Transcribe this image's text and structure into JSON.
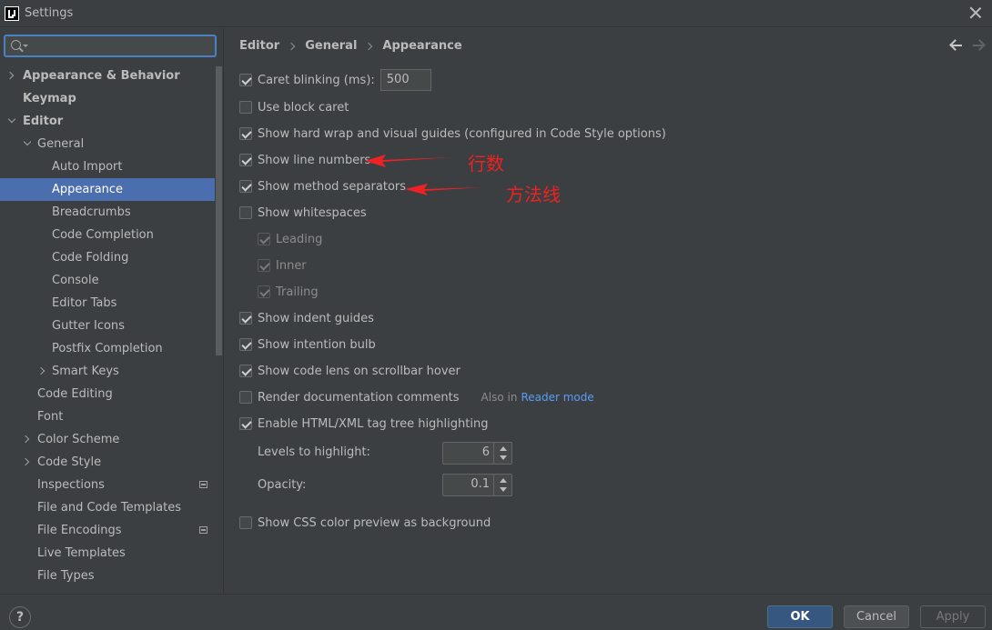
{
  "window": {
    "title": "Settings"
  },
  "search": {
    "value": "",
    "placeholder": ""
  },
  "sidebar": {
    "items": [
      {
        "label": "Appearance & Behavior"
      },
      {
        "label": "Keymap"
      },
      {
        "label": "Editor"
      },
      {
        "label": "General"
      },
      {
        "label": "Auto Import"
      },
      {
        "label": "Appearance"
      },
      {
        "label": "Breadcrumbs"
      },
      {
        "label": "Code Completion"
      },
      {
        "label": "Code Folding"
      },
      {
        "label": "Console"
      },
      {
        "label": "Editor Tabs"
      },
      {
        "label": "Gutter Icons"
      },
      {
        "label": "Postfix Completion"
      },
      {
        "label": "Smart Keys"
      },
      {
        "label": "Code Editing"
      },
      {
        "label": "Font"
      },
      {
        "label": "Color Scheme"
      },
      {
        "label": "Code Style"
      },
      {
        "label": "Inspections"
      },
      {
        "label": "File and Code Templates"
      },
      {
        "label": "File Encodings"
      },
      {
        "label": "Live Templates"
      },
      {
        "label": "File Types"
      }
    ]
  },
  "breadcrumb": {
    "c1": "Editor",
    "c2": "General",
    "c3": "Appearance"
  },
  "options": {
    "caret_blinking": "Caret blinking (ms):",
    "caret_blinking_value": "500",
    "block_caret": "Use block caret",
    "hard_wrap": "Show hard wrap and visual guides (configured in Code Style options)",
    "line_numbers": "Show line numbers",
    "method_separators": "Show method separators",
    "whitespaces": "Show whitespaces",
    "leading": "Leading",
    "inner": "Inner",
    "trailing": "Trailing",
    "indent_guides": "Show indent guides",
    "intention_bulb": "Show intention bulb",
    "code_lens": "Show code lens on scrollbar hover",
    "render_docs": "Render documentation comments",
    "also_in": "Also in",
    "reader_mode": "Reader mode",
    "html_xml": "Enable HTML/XML tag tree highlighting",
    "levels_label": "Levels to highlight:",
    "levels_value": "6",
    "opacity_label": "Opacity:",
    "opacity_value": "0.1",
    "css_preview": "Show CSS color preview as background"
  },
  "annotations": {
    "line_numbers_note": "行数",
    "method_separators_note": "方法线"
  },
  "footer": {
    "help": "?",
    "ok": "OK",
    "cancel": "Cancel",
    "apply": "Apply"
  },
  "colors": {
    "selection": "#4b6eaf",
    "annotation": "#ee2222",
    "link": "#589df6",
    "ok_button": "#365880"
  }
}
